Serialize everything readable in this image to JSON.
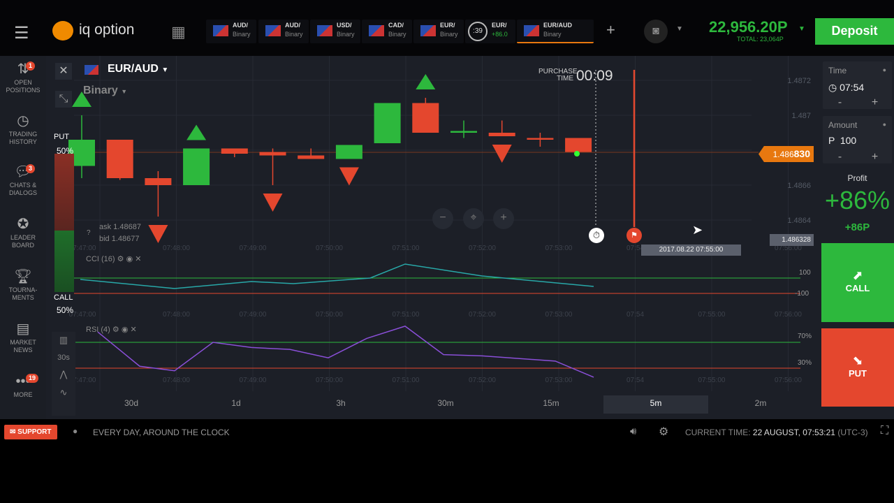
{
  "header": {
    "logo": "iq option",
    "tabs": [
      {
        "name": "AUD/",
        "sub": "Binary"
      },
      {
        "name": "AUD/",
        "sub": "Binary"
      },
      {
        "name": "USD/",
        "sub": "Binary"
      },
      {
        "name": "CAD/",
        "sub": "Binary"
      },
      {
        "name": "EUR/",
        "sub": "Binary"
      },
      {
        "name": "EUR/",
        "sub": "+86.0",
        "timer": ":39"
      },
      {
        "name": "EUR/AUD",
        "sub": "Binary"
      }
    ],
    "add": "+",
    "balance": "22,956.20P",
    "total": "TOTAL: 23,064P",
    "deposit": "Deposit"
  },
  "sidebar": {
    "items": [
      {
        "label": "OPEN POSITIONS",
        "icon": "arrows-icon",
        "badge": "1"
      },
      {
        "label": "TRADING HISTORY",
        "icon": "history-icon"
      },
      {
        "label": "CHATS & DIALOGS",
        "icon": "chat-icon",
        "badge": "3"
      },
      {
        "label": "LEADER BOARD",
        "icon": "medal-icon"
      },
      {
        "label": "TOURNA- MENTS",
        "icon": "trophy-icon"
      },
      {
        "label": "MARKET NEWS",
        "icon": "news-icon"
      },
      {
        "label": "MORE",
        "icon": "more-icon",
        "badge": "19"
      }
    ]
  },
  "chart": {
    "asset": "EUR/AUD",
    "type": "Binary",
    "purchase_label": "PURCHASE TIME",
    "purchase_time": "00:09",
    "put": "PUT",
    "put_pct": "50%",
    "call": "CALL",
    "call_pct": "50%",
    "ask": "ask 1.48687",
    "bid": "bid 1.48677",
    "current_price_prefix": "1.486",
    "current_price_suffix": "830",
    "cursor_price": "1.486328",
    "expiry_label": "2017.08.22 07:55:00",
    "y_ticks": [
      "1.4872",
      "1.487",
      "1.4866",
      "1.4864"
    ],
    "x_ticks": [
      "07:47:00",
      "07:48:00",
      "07:49:00",
      "07:50:00",
      "07:51:00",
      "07:52:00",
      "07:53:00",
      "07:54",
      "07:55:00",
      "07:56:00"
    ],
    "candles": [
      [
        1.48671,
        1.487,
        1.48664,
        1.48686
      ],
      [
        1.48686,
        1.48686,
        1.48663,
        1.48664
      ],
      [
        1.48664,
        1.48668,
        1.48642,
        1.4866
      ],
      [
        1.4866,
        1.48681,
        1.4866,
        1.48681
      ],
      [
        1.48681,
        1.48681,
        1.48676,
        1.48678
      ],
      [
        1.48679,
        1.48681,
        1.4866,
        1.48677
      ],
      [
        1.48677,
        1.48681,
        1.48675,
        1.48675
      ],
      [
        1.48675,
        1.48683,
        1.48675,
        1.48683
      ],
      [
        1.48684,
        1.48707,
        1.48684,
        1.48707
      ],
      [
        1.48707,
        1.4871,
        1.4869,
        1.4869
      ],
      [
        1.4869,
        1.48697,
        1.48687,
        1.48691
      ],
      [
        1.4869,
        1.48697,
        1.48688,
        1.48688
      ],
      [
        1.48687,
        1.4869,
        1.48682,
        1.48686
      ],
      [
        1.48687,
        1.48687,
        1.48679,
        1.48679
      ]
    ],
    "deals": [
      {
        "candle": 0,
        "dir": "call"
      },
      {
        "candle": 3,
        "dir": "call"
      },
      {
        "candle": 9,
        "dir": "call"
      },
      {
        "candle": 2,
        "dir": "put"
      },
      {
        "candle": 5,
        "dir": "put"
      },
      {
        "candle": 7,
        "dir": "put"
      },
      {
        "candle": 11,
        "dir": "put"
      }
    ],
    "cci": {
      "label": "CCI (16)",
      "levels": [
        "100",
        "-100"
      ],
      "values": [
        82,
        -36,
        55,
        27,
        100,
        282,
        127,
        -9
      ]
    },
    "rsi": {
      "label": "RSI (4)",
      "levels": [
        "70%",
        "30%"
      ],
      "values": [
        86,
        33,
        26,
        70,
        62,
        59,
        46,
        76,
        95,
        51,
        49,
        41,
        16
      ]
    },
    "timeframe_left": "30s",
    "timeframes": [
      "30d",
      "1d",
      "3h",
      "30m",
      "15m",
      "5m",
      "2m"
    ],
    "active_timeframe": "5m"
  },
  "panel": {
    "time_label": "Time",
    "time": "07:54",
    "amount_label": "Amount",
    "amount": "P  100",
    "profit_label": "Profit",
    "profit_pct": "+86%",
    "profit_amt": "+86P",
    "call": "CALL",
    "put": "PUT",
    "minus": "-",
    "plus": "+"
  },
  "footer": {
    "support": "SUPPORT",
    "tagline": "EVERY DAY, AROUND THE CLOCK",
    "time_label": "CURRENT TIME:",
    "time_value": "22 AUGUST, 07:53:21",
    "tz": "(UTC-3)"
  },
  "colors": {
    "green": "#2db83d",
    "red": "#e4472e",
    "orange": "#e8780f",
    "cci": "#28a8a8",
    "rsi": "#8a4fd8"
  }
}
